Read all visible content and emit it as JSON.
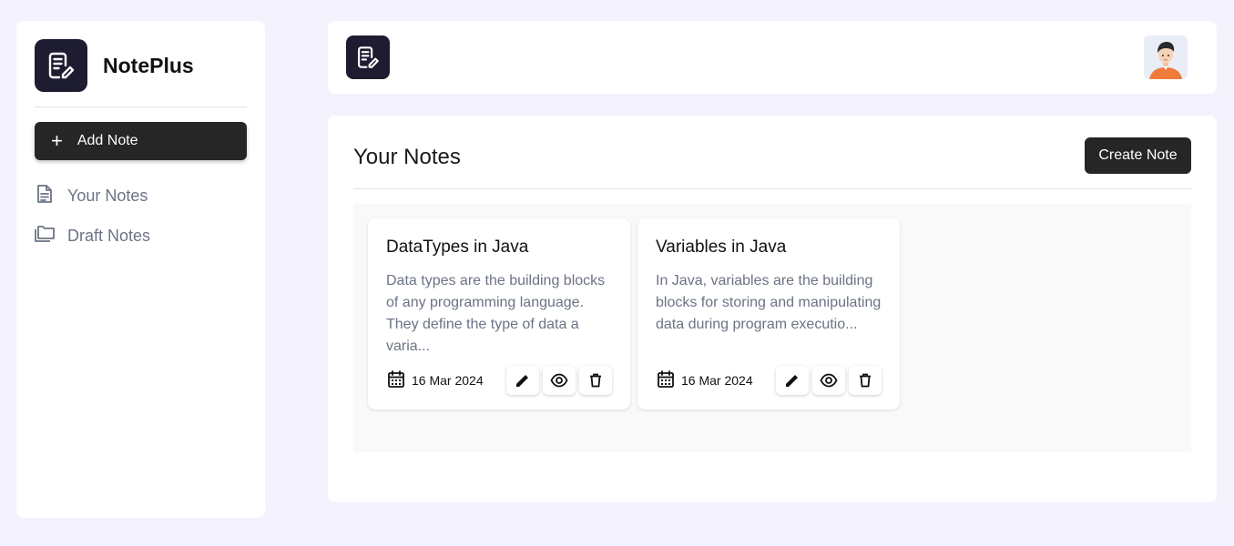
{
  "sidebar": {
    "app_name": "NotePlus",
    "add_note_label": "Add Note",
    "items": [
      {
        "label": "Your Notes",
        "icon": "document-icon"
      },
      {
        "label": "Draft Notes",
        "icon": "folders-icon"
      }
    ]
  },
  "main": {
    "title": "Your Notes",
    "create_label": "Create Note",
    "notes": [
      {
        "title": "DataTypes in Java",
        "body": "Data types are the building blocks of any programming language. They define the type of data a varia...",
        "date": "16 Mar 2024"
      },
      {
        "title": "Variables in Java",
        "body": "In Java, variables are the building blocks for storing and manipulating data during program executio...",
        "date": "16 Mar 2024"
      }
    ]
  },
  "colors": {
    "background": "#f4f2fd",
    "brand_dark": "#1e1c30",
    "button_dark": "#262626",
    "muted_text": "#6b7384"
  }
}
